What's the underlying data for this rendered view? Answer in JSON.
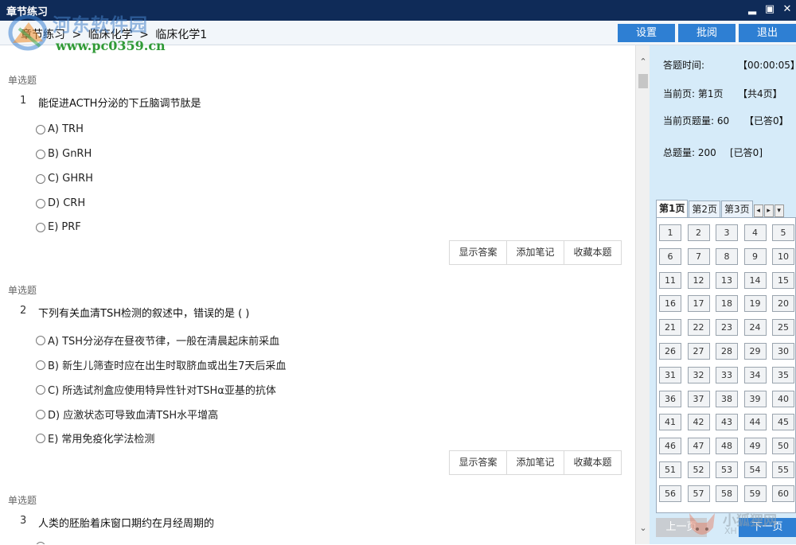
{
  "window": {
    "title": "章节练习",
    "controls": [
      "▂",
      "▣",
      "✕"
    ]
  },
  "watermark": {
    "name": "河东软件园",
    "url": "www.pc0359.cn"
  },
  "header": {
    "breadcrumb": [
      "章节练习",
      ">",
      "临床化学",
      ">",
      "临床化学1"
    ],
    "buttons": {
      "settings": "设置",
      "review": "批阅",
      "exit": "退出"
    }
  },
  "questions": [
    {
      "type": "单选题",
      "number": "1",
      "text": "能促进ACTH分泌的下丘脑调节肽是",
      "options": [
        "A) TRH",
        "B) GnRH",
        "C) GHRH",
        "D) CRH",
        "E) PRF"
      ]
    },
    {
      "type": "单选题",
      "number": "2",
      "text": "下列有关血清TSH检测的叙述中，错误的是 ( )",
      "options": [
        "A) TSH分泌存在昼夜节律，一般在清晨起床前采血",
        "B) 新生儿筛查时应在出生时取脐血或出生7天后采血",
        "C) 所选试剂盒应使用特异性针对TSHα亚基的抗体",
        "D) 应激状态可导致血清TSH水平增高",
        "E) 常用免疫化学法检测"
      ]
    },
    {
      "type": "单选题",
      "number": "3",
      "text": "人类的胚胎着床窗口期约在月经周期的",
      "options": []
    }
  ],
  "question_actions": {
    "show_answer": "显示答案",
    "add_note": "添加笔记",
    "favorite": "收藏本题"
  },
  "panel": {
    "time_label": "答题时间:",
    "time_value": "【00:00:05】",
    "page_label": "当前页: 第1页",
    "page_total": "【共4页】",
    "page_count_label": "当前页题量: 60",
    "page_answered": "【已答0】",
    "total_label": "总题量: 200",
    "total_answered": "[已答0]",
    "tabs": [
      "第1页",
      "第2页",
      "第3页"
    ],
    "numbers": [
      "1",
      "2",
      "3",
      "4",
      "5",
      "6",
      "7",
      "8",
      "9",
      "10",
      "11",
      "12",
      "13",
      "14",
      "15",
      "16",
      "17",
      "18",
      "19",
      "20",
      "21",
      "22",
      "23",
      "24",
      "25",
      "26",
      "27",
      "28",
      "29",
      "30",
      "31",
      "32",
      "33",
      "34",
      "35",
      "36",
      "37",
      "38",
      "39",
      "40",
      "41",
      "42",
      "43",
      "44",
      "45",
      "46",
      "47",
      "48",
      "49",
      "50",
      "51",
      "52",
      "53",
      "54",
      "55",
      "56",
      "57",
      "58",
      "59",
      "60"
    ],
    "prev": "上一页",
    "next": "下一页"
  },
  "watermark2": {
    "name": "小狐狸网",
    "sub": "XH"
  },
  "colors": {
    "titlebar": "#0f2b58",
    "accent": "#2e7fd3",
    "panel": "#d6ebf9"
  }
}
